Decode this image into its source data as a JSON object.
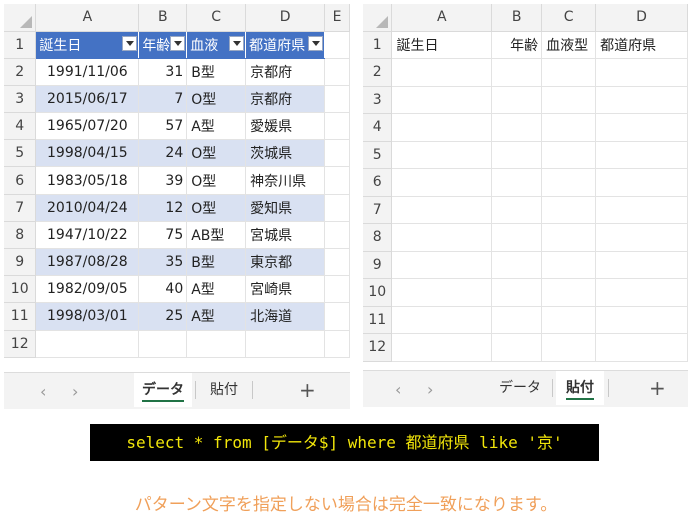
{
  "left": {
    "columns": [
      "A",
      "B",
      "C",
      "D",
      "E"
    ],
    "row_numbers": [
      "1",
      "2",
      "3",
      "4",
      "5",
      "6",
      "7",
      "8",
      "9",
      "10",
      "11",
      "12"
    ],
    "headers": [
      "誕生日",
      "年齢",
      "血液型",
      "都道府県"
    ],
    "headers_visible": [
      "誕生日",
      "年齢",
      "血液",
      "都道府県"
    ],
    "rows": [
      [
        "1991/11/06",
        "31",
        "B型",
        "京都府"
      ],
      [
        "2015/06/17",
        "7",
        "O型",
        "京都府"
      ],
      [
        "1965/07/20",
        "57",
        "A型",
        "愛媛県"
      ],
      [
        "1998/04/15",
        "24",
        "O型",
        "茨城県"
      ],
      [
        "1983/05/18",
        "39",
        "O型",
        "神奈川県"
      ],
      [
        "2010/04/24",
        "12",
        "O型",
        "愛知県"
      ],
      [
        "1947/10/22",
        "75",
        "AB型",
        "宮城県"
      ],
      [
        "1987/08/28",
        "35",
        "B型",
        "東京都"
      ],
      [
        "1982/09/05",
        "40",
        "A型",
        "宮崎県"
      ],
      [
        "1998/03/01",
        "25",
        "A型",
        "北海道"
      ]
    ],
    "tabs": {
      "nav_prev": "‹",
      "nav_next": "›",
      "sheet1": "データ",
      "sheet2": "貼付",
      "add": "+"
    }
  },
  "right": {
    "columns": [
      "A",
      "B",
      "C",
      "D"
    ],
    "row_numbers": [
      "1",
      "2",
      "3",
      "4",
      "5",
      "6",
      "7",
      "8",
      "9",
      "10",
      "11",
      "12"
    ],
    "headers": [
      "誕生日",
      "年齢",
      "血液型",
      "都道府県"
    ],
    "tabs": {
      "nav_prev": "‹",
      "nav_next": "›",
      "sheet1": "データ",
      "sheet2": "貼付",
      "add": "+"
    }
  },
  "sql": "select * from [データ$] where 都道府県 like '京'",
  "note": "パターン文字を指定しない場合は完全一致になります。",
  "colors": {
    "table_header": "#4472c4",
    "band": "#d9e1f2",
    "sql_bg": "#000000",
    "sql_text": "#f2e60a",
    "note": "#f0a05a",
    "active_tab_underline": "#217346"
  }
}
